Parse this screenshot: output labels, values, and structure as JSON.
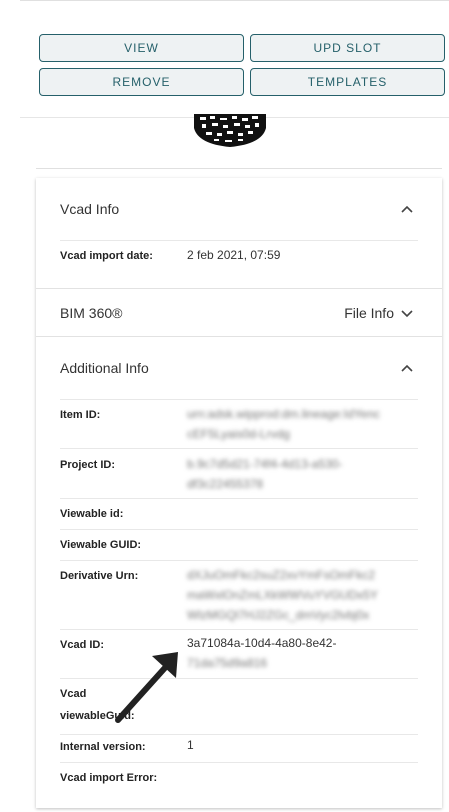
{
  "actions": {
    "view": "VIEW",
    "upd_slot": "UPD SLOT",
    "remove": "REMOVE",
    "templates": "TEMPLATES"
  },
  "vcad_info": {
    "title": "Vcad Info",
    "import_date_label": "Vcad import date:",
    "import_date_value": "2 feb 2021, 07:59"
  },
  "bim360": {
    "title": "BIM 360®",
    "file_info": "File Info"
  },
  "additional_info": {
    "title": "Additional Info",
    "rows": [
      {
        "label": "Item ID:",
        "value": "urn:adsk.wipprod:dm.lineage:IdYenc",
        "value2": "cEF5Lyais0d-Lrvdg"
      },
      {
        "label": "Project ID:",
        "value": "b.9c7d5d21-74f4-4d13-a530-",
        "value2": "df3c22455378"
      },
      {
        "label": "Viewable id:",
        "value": ""
      },
      {
        "label": "Viewable GUID:",
        "value": ""
      },
      {
        "label": "Derivative Urn:",
        "value": "dXJuOmFkc2suZ2xvYmFsOmFkc2",
        "value2": "maWxlOnZmLXkWWVuYVGUDx5Y",
        "value3": "WlzMGQl7HJ2ZGc_dmVyc2lvbj0x"
      },
      {
        "label": "Vcad ID:",
        "value": "3a71084a-10d4-4a80-8e42-",
        "value2": "71da75d9a816"
      },
      {
        "label": "Vcad",
        "label2": "viewableGuid:",
        "value": ""
      },
      {
        "label": "Internal version:",
        "value": "1"
      },
      {
        "label": "Vcad import Error:",
        "value": ""
      }
    ]
  },
  "icons": {
    "collapse": "chevron-up-icon",
    "expand": "chevron-down-icon"
  }
}
